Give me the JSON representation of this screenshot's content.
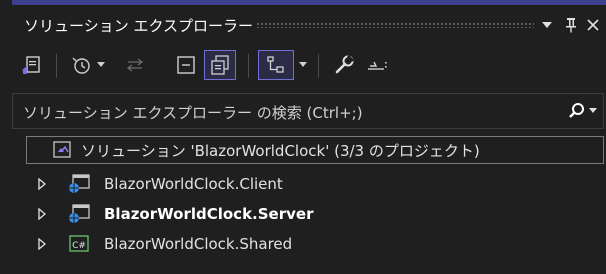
{
  "panel": {
    "title": "ソリューション エクスプローラー",
    "pin_glyph": "⊥",
    "close_glyph": "✕",
    "dropdown_glyph": "▼"
  },
  "search": {
    "placeholder": "ソリューション エクスプローラー の検索 (Ctrl+;)"
  },
  "tree": {
    "solution_label": "ソリューション 'BlazorWorldClock' (3/3 のプロジェクト)",
    "projects": [
      {
        "label": "BlazorWorldClock.Client",
        "icon": "web-project-icon",
        "bold": false
      },
      {
        "label": "BlazorWorldClock.Server",
        "icon": "web-project-icon",
        "bold": true
      },
      {
        "label": "BlazorWorldClock.Shared",
        "icon": "csharp-project-icon",
        "bold": false
      }
    ]
  },
  "colors": {
    "accent": "#6f6fd6",
    "background": "#1f1f1f",
    "web_icon_blue": "#3a8ee6",
    "csharp_green": "#6cc36c"
  }
}
